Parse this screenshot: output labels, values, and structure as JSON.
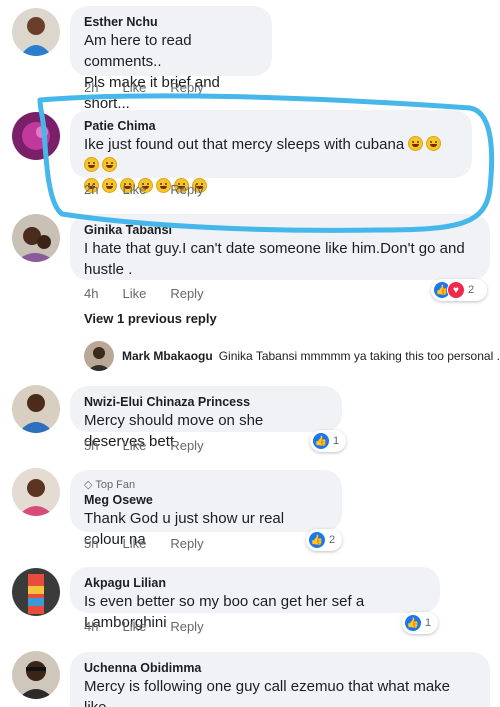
{
  "comments": [
    {
      "author": "Esther Nchu",
      "text": "Am here to read comments..\nPls make it brief and short...",
      "time": "2h",
      "like": "Like",
      "reply": "Reply"
    },
    {
      "author": "Patie Chima",
      "text": "Ike just found out that mercy sleeps with cubana",
      "time": "2h",
      "like": "Like",
      "reply": "Reply"
    },
    {
      "author": "Ginika Tabansi",
      "text": "I hate that guy.I  can't date someone like him.Don't go and hustle .",
      "time": "4h",
      "like": "Like",
      "reply": "Reply",
      "reaction_count": "2"
    },
    {
      "author": "Nwizi-Elui Chinaza Princess",
      "text": "Mercy should move on she deserves bett",
      "time": "5h",
      "like": "Like",
      "reply": "Reply",
      "reaction_count": "1"
    },
    {
      "badge": "Top Fan",
      "author": "Meg Osewe",
      "text": "Thank God u just show ur real colour na",
      "time": "5h",
      "like": "Like",
      "reply": "Reply",
      "reaction_count": "2"
    },
    {
      "author": "Akpagu Lilian",
      "text": "Is even better so my boo can get her sef a Lamborghini",
      "time": "4h",
      "like": "Like",
      "reply": "Reply",
      "reaction_count": "1"
    },
    {
      "author": "Uchenna Obidimma",
      "text": "Mercy is following one guy call ezemuo that what make like"
    }
  ],
  "view_previous": "View 1 previous reply",
  "reply_preview": {
    "author": "Mark Mbakaogu",
    "text": "Ginika Tabansi mmmmm ya taking this too personal ..."
  },
  "colors": {
    "bubble": "#f0f2f5",
    "annotation": "#45b7ea",
    "like_blue": "#1877f2",
    "love_red": "#f0284a"
  },
  "icons": {
    "emoji": "grinning-face-icon",
    "like": "thumbs-up-icon",
    "love": "heart-icon",
    "badge": "diamond-icon"
  }
}
